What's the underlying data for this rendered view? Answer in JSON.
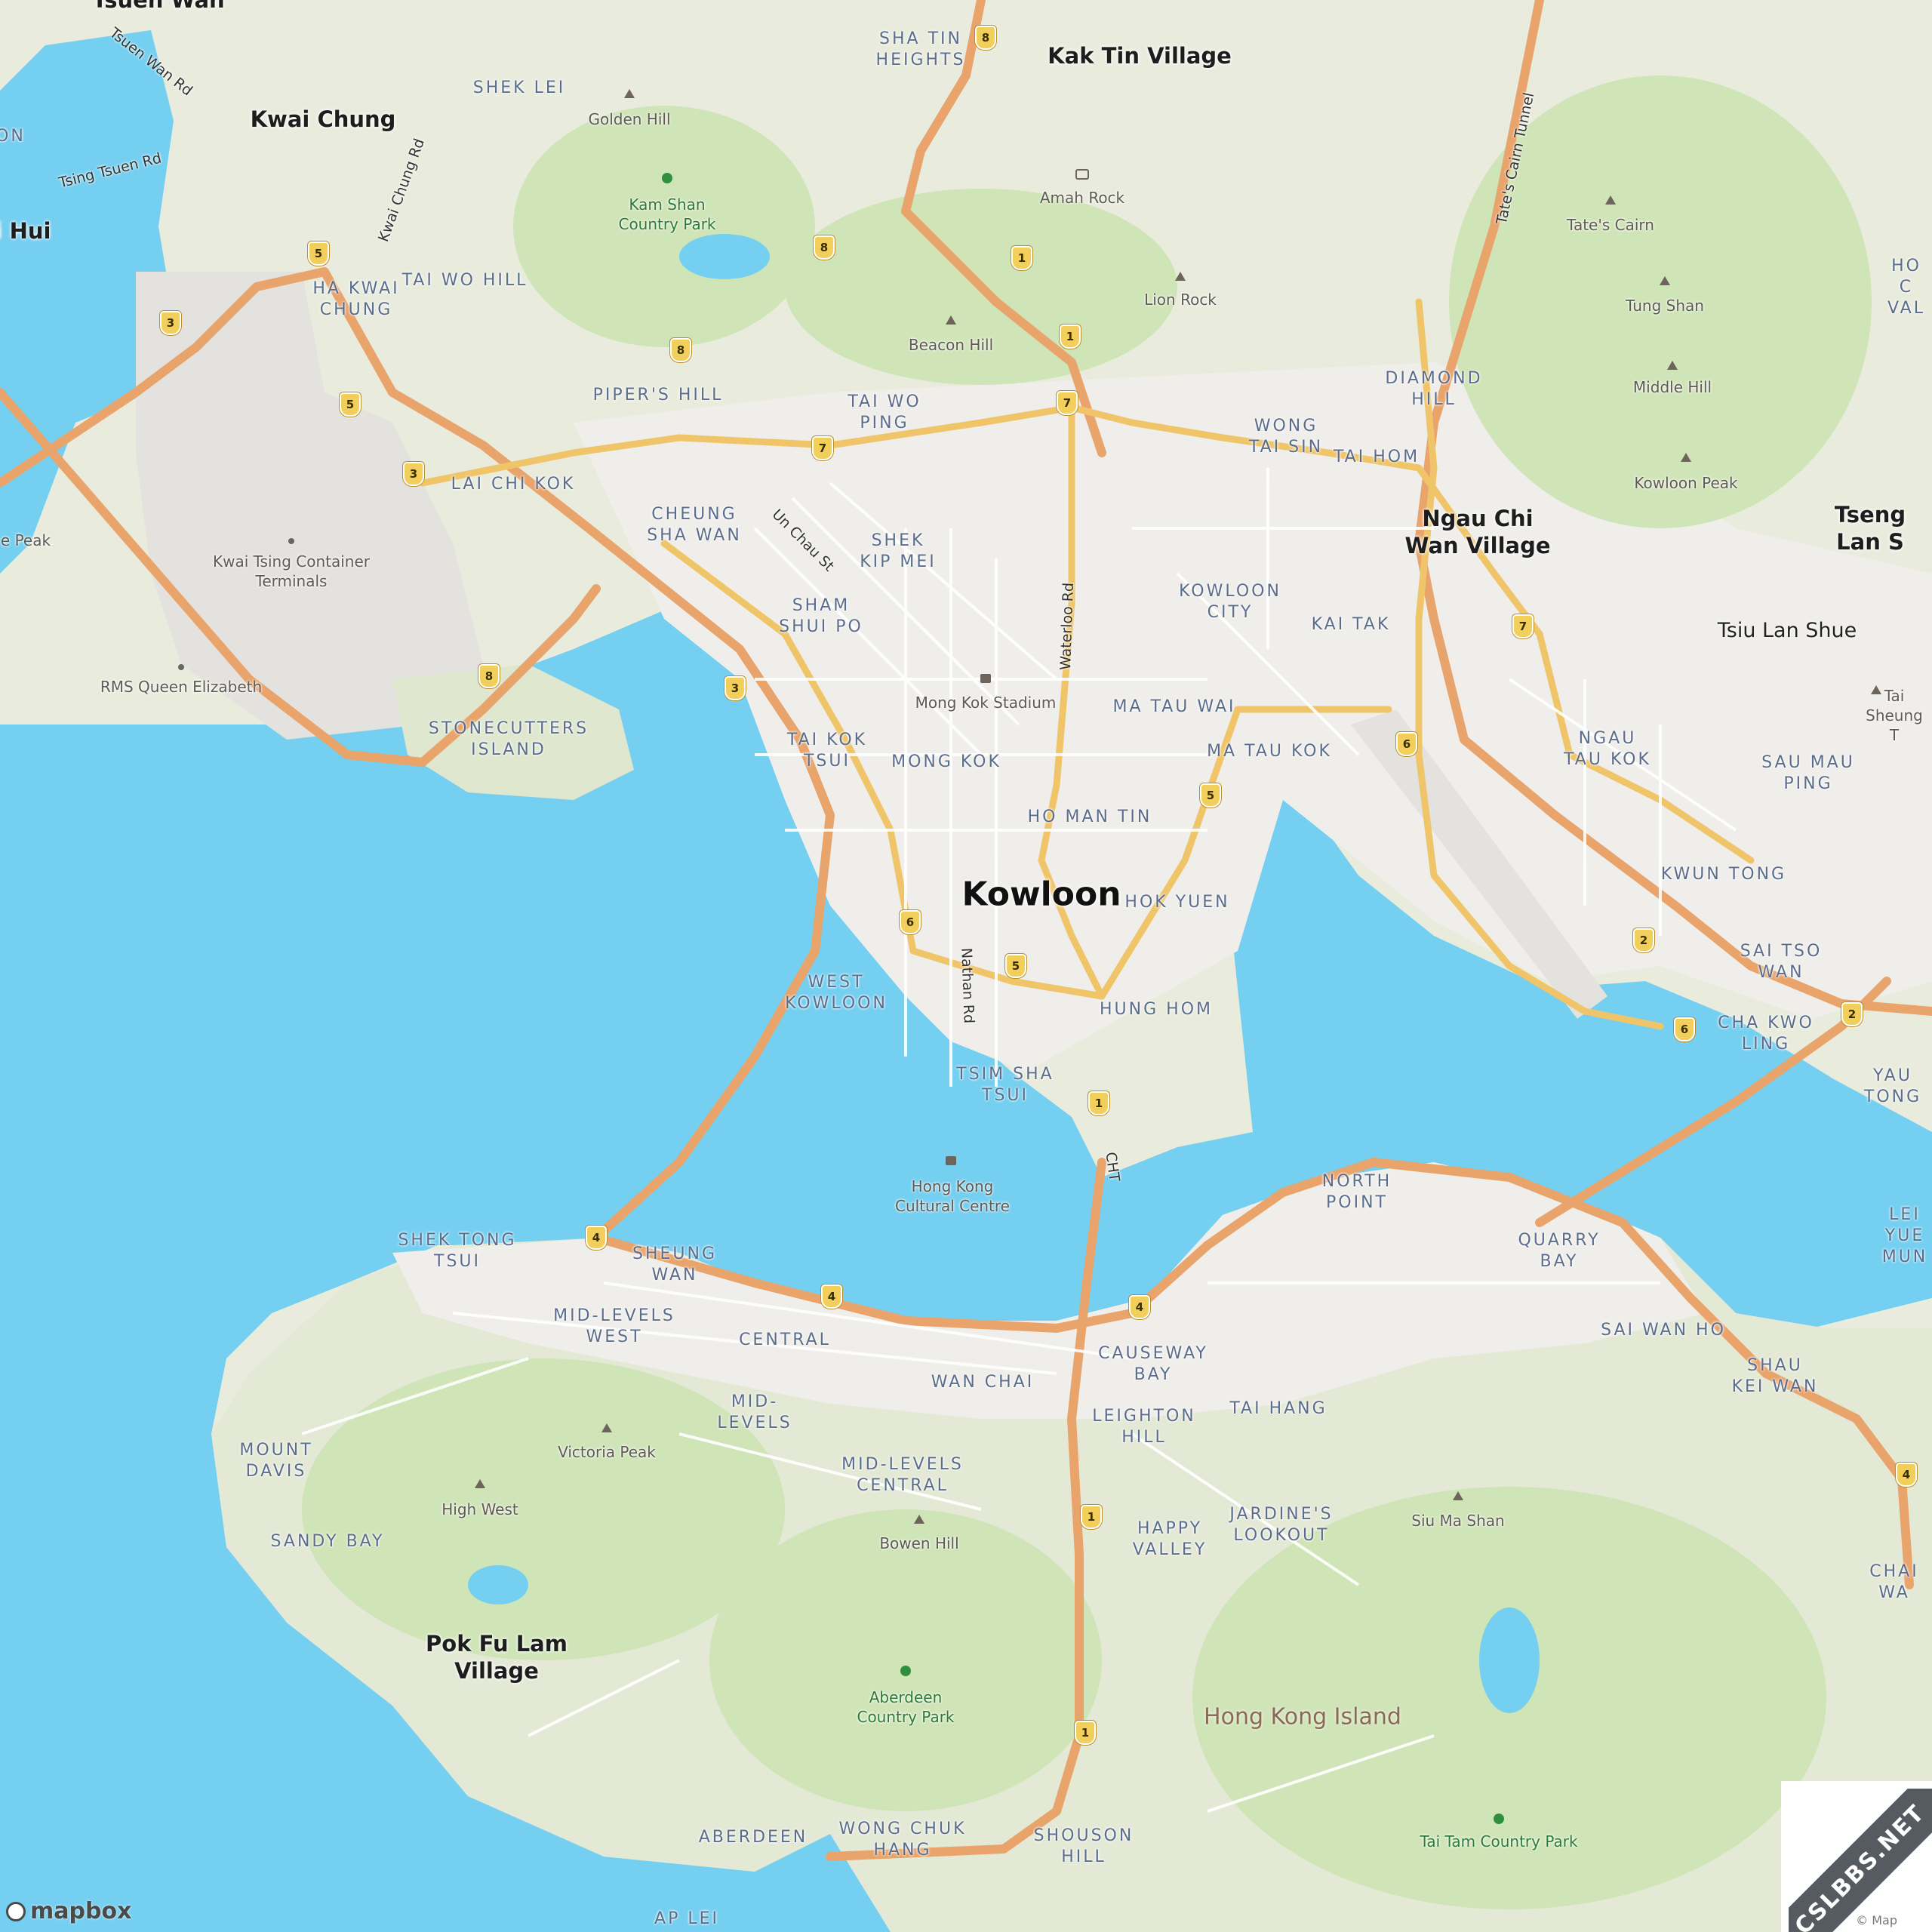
{
  "colors": {
    "water": "#75cff0",
    "land": "#e9ecdd",
    "park": "#cfe4b7",
    "urban": "#f0eeea",
    "road_major": "#e9a46c",
    "road_trunk": "#f0c56a",
    "road_minor": "#ffffff"
  },
  "labels": {
    "city": [
      {
        "id": "kowloon",
        "text": "Kowloon"
      }
    ],
    "towns": [
      {
        "id": "kak-tin-village",
        "text": "Kak Tin Village"
      },
      {
        "id": "kwai-chung",
        "text": "Kwai Chung"
      },
      {
        "id": "ngau-chi-wan-village",
        "text": "Ngau Chi\nWan Village"
      },
      {
        "id": "tseng-lan-shue",
        "text": "Tseng Lan S"
      },
      {
        "id": "tsiu-lan-shue",
        "text": "Tsiu Lan Shue"
      },
      {
        "id": "pok-fu-lam-village",
        "text": "Pok Fu Lam\nVillage"
      },
      {
        "id": "tsuen-wan",
        "text": "Tsuen Wan"
      },
      {
        "id": "hui",
        "text": "i Hui"
      }
    ],
    "island": [
      {
        "id": "hong-kong-island",
        "text": "Hong Kong Island"
      }
    ],
    "districts": [
      {
        "id": "sha-tin-heights",
        "text": "SHA TIN\nHEIGHTS"
      },
      {
        "id": "shek-lei",
        "text": "SHEK LEI"
      },
      {
        "id": "ha-kwai-chung",
        "text": "HA KWAI\nCHUNG"
      },
      {
        "id": "tai-wo-hill",
        "text": "TAI WO HILL"
      },
      {
        "id": "pipers-hill",
        "text": "PIPER'S HILL"
      },
      {
        "id": "tai-wo-ping",
        "text": "TAI WO\nPING"
      },
      {
        "id": "lai-chi-kok",
        "text": "LAI CHI KOK"
      },
      {
        "id": "cheung-sha-wan",
        "text": "CHEUNG\nSHA WAN"
      },
      {
        "id": "shek-kip-mei",
        "text": "SHEK\nKIP MEI"
      },
      {
        "id": "sham-shui-po",
        "text": "SHAM\nSHUI PO"
      },
      {
        "id": "diamond-hill",
        "text": "DIAMOND\nHILL"
      },
      {
        "id": "wong-tai-sin",
        "text": "WONG\nTAI SIN"
      },
      {
        "id": "tai-hom",
        "text": "TAI HOM"
      },
      {
        "id": "kowloon-city",
        "text": "KOWLOON\nCITY"
      },
      {
        "id": "kai-tak",
        "text": "KAI TAK"
      },
      {
        "id": "stonecutters-island",
        "text": "STONECUTTERS\nISLAND"
      },
      {
        "id": "tai-kok-tsui",
        "text": "TAI KOK\nTSUI"
      },
      {
        "id": "mong-kok",
        "text": "MONG KOK"
      },
      {
        "id": "ma-tau-wai",
        "text": "MA TAU WAI"
      },
      {
        "id": "ma-tau-kok",
        "text": "MA TAU KOK"
      },
      {
        "id": "ho-man-tin",
        "text": "HO MAN TIN"
      },
      {
        "id": "ngau-tau-kok",
        "text": "NGAU\nTAU KOK"
      },
      {
        "id": "sau-mau-ping",
        "text": "SAU MAU\nPING"
      },
      {
        "id": "kwun-tong",
        "text": "KWUN TONG"
      },
      {
        "id": "hok-yuen",
        "text": "HOK YUEN"
      },
      {
        "id": "west-kowloon",
        "text": "WEST\nKOWLOON"
      },
      {
        "id": "hung-hom",
        "text": "HUNG HOM"
      },
      {
        "id": "tsim-sha-tsui",
        "text": "TSIM SHA\nTSUI"
      },
      {
        "id": "sai-tso-wan",
        "text": "SAI TSO\nWAN"
      },
      {
        "id": "cha-kwo-ling",
        "text": "CHA KWO\nLING"
      },
      {
        "id": "yau-tong",
        "text": "YAU TONG"
      },
      {
        "id": "north-point",
        "text": "NORTH\nPOINT"
      },
      {
        "id": "quarry-bay",
        "text": "QUARRY\nBAY"
      },
      {
        "id": "lei-yue-mun",
        "text": "LEI YUE\nMUN"
      },
      {
        "id": "shek-tong-tsui",
        "text": "SHEK TONG\nTSUI"
      },
      {
        "id": "sheung-wan",
        "text": "SHEUNG\nWAN"
      },
      {
        "id": "mid-levels-west",
        "text": "MID-LEVELS\nWEST"
      },
      {
        "id": "central",
        "text": "CENTRAL"
      },
      {
        "id": "causeway-bay",
        "text": "CAUSEWAY\nBAY"
      },
      {
        "id": "sai-wan-ho",
        "text": "SAI WAN HO"
      },
      {
        "id": "shau-kei-wan",
        "text": "SHAU\nKEI WAN"
      },
      {
        "id": "wan-chai",
        "text": "WAN CHAI"
      },
      {
        "id": "mid-levels",
        "text": "MID-\nLEVELS"
      },
      {
        "id": "leighton-hill",
        "text": "LEIGHTON\nHILL"
      },
      {
        "id": "tai-hang",
        "text": "TAI HANG"
      },
      {
        "id": "mount-davis",
        "text": "MOUNT\nDAVIS"
      },
      {
        "id": "mid-levels-central",
        "text": "MID-LEVELS\nCENTRAL"
      },
      {
        "id": "sandy-bay",
        "text": "SANDY BAY"
      },
      {
        "id": "happy-valley",
        "text": "HAPPY\nVALLEY"
      },
      {
        "id": "jardines-lookout",
        "text": "JARDINE'S\nLOOKOUT"
      },
      {
        "id": "chai-wan",
        "text": "CHAI WA"
      },
      {
        "id": "aberdeen",
        "text": "ABERDEEN"
      },
      {
        "id": "wong-chuk-hang",
        "text": "WONG CHUK\nHANG"
      },
      {
        "id": "shouson-hill",
        "text": "SHOUSON\nHILL"
      },
      {
        "id": "ap-lei",
        "text": "AP LEI"
      },
      {
        "id": "ho-chung-vale",
        "text": "HO C\nVAL"
      },
      {
        "id": "on",
        "text": "ON"
      }
    ],
    "pois": [
      {
        "id": "golden-hill",
        "text": "Golden Hill",
        "icon": "peak-icon"
      },
      {
        "id": "amah-rock",
        "text": "Amah Rock",
        "icon": "camera-icon"
      },
      {
        "id": "lion-rock",
        "text": "Lion Rock",
        "icon": "peak-icon"
      },
      {
        "id": "beacon-hill",
        "text": "Beacon Hill",
        "icon": "peak-icon"
      },
      {
        "id": "tates-cairn",
        "text": "Tate's Cairn",
        "icon": "peak-icon"
      },
      {
        "id": "tung-shan",
        "text": "Tung Shan",
        "icon": "peak-icon"
      },
      {
        "id": "middle-hill",
        "text": "Middle Hill",
        "icon": "peak-icon"
      },
      {
        "id": "kowloon-peak",
        "text": "Kowloon Peak",
        "icon": "peak-icon"
      },
      {
        "id": "kwai-tsing-container",
        "text": "Kwai Tsing Container\nTerminals",
        "icon": "dot-icon"
      },
      {
        "id": "rms-queen-elizabeth",
        "text": "RMS Queen Elizabeth",
        "icon": "dot-icon"
      },
      {
        "id": "mong-kok-stadium",
        "text": "Mong Kok Stadium",
        "icon": "stadium-icon"
      },
      {
        "id": "hong-kong-cultural-centre",
        "text": "Hong Kong\nCultural Centre",
        "icon": "building-icon"
      },
      {
        "id": "victoria-peak",
        "text": "Victoria Peak",
        "icon": "peak-icon"
      },
      {
        "id": "high-west",
        "text": "High West",
        "icon": "peak-icon"
      },
      {
        "id": "bowen-hill",
        "text": "Bowen Hill",
        "icon": "peak-icon"
      },
      {
        "id": "siu-ma-shan",
        "text": "Siu Ma Shan",
        "icon": "peak-icon"
      },
      {
        "id": "tai-sheung",
        "text": "Tai Sheung T",
        "icon": "peak-icon"
      },
      {
        "id": "e-peak",
        "text": "e Peak",
        "icon": "none"
      }
    ],
    "parks": [
      {
        "id": "kam-shan-country-park",
        "text": "Kam Shan\nCountry Park"
      },
      {
        "id": "aberdeen-country-park",
        "text": "Aberdeen\nCountry Park"
      },
      {
        "id": "tai-tam-country-park",
        "text": "Tai Tam Country Park"
      }
    ],
    "roads": [
      {
        "id": "tsuen-wan-rd",
        "text": "Tsuen Wan Rd"
      },
      {
        "id": "tsing-tsuen-rd",
        "text": "Tsing Tsuen Rd"
      },
      {
        "id": "kwai-chung-rd",
        "text": "Kwai Chung Rd"
      },
      {
        "id": "tates-cairn-tunnel",
        "text": "Tate's Cairn Tunnel"
      },
      {
        "id": "un-chau-st",
        "text": "Un Chau St"
      },
      {
        "id": "waterloo-rd",
        "text": "Waterloo Rd"
      },
      {
        "id": "nathan-rd",
        "text": "Nathan Rd"
      },
      {
        "id": "cht",
        "text": "CHT"
      }
    ]
  },
  "shields": [
    "8",
    "5",
    "8",
    "3",
    "8",
    "5",
    "1",
    "1",
    "3",
    "7",
    "7",
    "7",
    "3",
    "8",
    "6",
    "5",
    "6",
    "5",
    "2",
    "1",
    "6",
    "2",
    "4",
    "4",
    "4",
    "1",
    "1",
    "4"
  ],
  "logo": {
    "text": "mapbox"
  },
  "attribution": "© Map",
  "watermark": "CSLBBS.NET"
}
